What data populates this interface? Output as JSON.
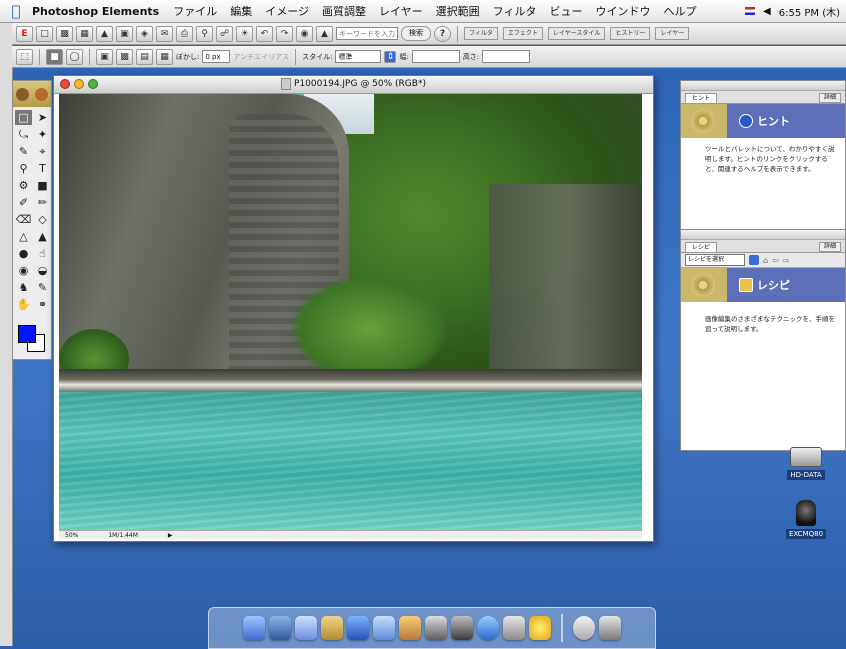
{
  "menubar": {
    "app_name": "Photoshop Elements",
    "items": [
      "ファイル",
      "編集",
      "イメージ",
      "画質調整",
      "レイヤー",
      "選択範囲",
      "フィルタ",
      "ビュー",
      "ウインドウ",
      "ヘルプ"
    ],
    "clock": "6:55 PM (木)"
  },
  "toolbar1": {
    "search_placeholder": "キーワードを入力",
    "search_button": "検索",
    "palette_tabs": [
      "フィルタ",
      "エフェクト",
      "レイヤースタイル",
      "ヒストリー",
      "レイヤー"
    ]
  },
  "toolbar2": {
    "feather_label": "ぼかし:",
    "feather_value": "0 px",
    "antialias_label": "アンチエイリアス",
    "style_label": "スタイル:",
    "style_value": "標準",
    "width_label": "幅:",
    "height_label": "高さ:"
  },
  "document": {
    "title": "P1000194.JPG @ 50% (RGB*)",
    "zoom": "50%",
    "doc_size": "1M/1.44M"
  },
  "hints_palette": {
    "tab": "ヒント",
    "more_button": "詳細",
    "header": "ヒント",
    "body": "ツールとパレットについて、わかりやすく説明します。ヒントのリンクをクリックすると、関連するヘルプを表示できます。"
  },
  "recipes_palette": {
    "tab": "レシピ",
    "more_button": "詳細",
    "select_value": "レシピを選択",
    "header": "レシピ",
    "body": "画像編集のさまざまなテクニックを、手順を追って説明します。"
  },
  "desktop": {
    "hd_label": "HD-DATA",
    "camera_label": "EXCMQ80"
  },
  "colors": {
    "foreground": "#0018ff",
    "background": "#ffffff",
    "desktop": "#3a6fc2",
    "palette_banner": "#5d6fb8"
  }
}
